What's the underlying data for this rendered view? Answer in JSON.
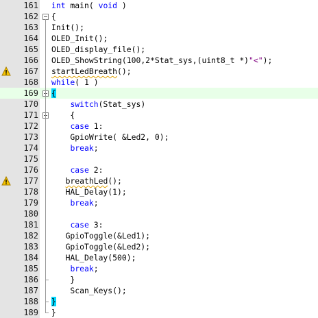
{
  "editor": {
    "lines": [
      {
        "n": "161",
        "segs": [
          {
            "t": "int",
            "c": "kw"
          },
          {
            "t": " main( "
          },
          {
            "t": "void",
            "c": "kw"
          },
          {
            "t": " )"
          }
        ]
      },
      {
        "n": "162",
        "fold": "open",
        "segs": [
          {
            "t": "{"
          }
        ]
      },
      {
        "n": "163",
        "segs": [
          {
            "t": "Init();"
          }
        ]
      },
      {
        "n": "164",
        "segs": [
          {
            "t": "OLED_Init();"
          }
        ]
      },
      {
        "n": "165",
        "segs": [
          {
            "t": "OLED_display_file();"
          }
        ]
      },
      {
        "n": "166",
        "segs": [
          {
            "t": "OLED_ShowString("
          },
          {
            "t": "100",
            "c": "num"
          },
          {
            "t": ","
          },
          {
            "t": "2",
            "c": "num"
          },
          {
            "t": "*Stat_sys,(uint8_t *)"
          },
          {
            "t": "\"<\"",
            "c": "str"
          },
          {
            "t": ");"
          }
        ]
      },
      {
        "n": "167",
        "warn": true,
        "segs": [
          {
            "t": "startLedBreath",
            "c": "warn"
          },
          {
            "t": "();"
          }
        ]
      },
      {
        "n": "168",
        "segs": [
          {
            "t": "while",
            "c": "kw"
          },
          {
            "t": "( "
          },
          {
            "t": "1",
            "c": "num"
          },
          {
            "t": " )"
          }
        ]
      },
      {
        "n": "169",
        "fold": "open",
        "current": true,
        "segs": [
          {
            "t": "{",
            "c": "cursor-brace"
          }
        ]
      },
      {
        "n": "170",
        "segs": [
          {
            "t": "    "
          },
          {
            "t": "switch",
            "c": "kw"
          },
          {
            "t": "(Stat_sys)"
          }
        ]
      },
      {
        "n": "171",
        "fold": "open",
        "segs": [
          {
            "t": "    {"
          }
        ]
      },
      {
        "n": "172",
        "segs": [
          {
            "t": "    "
          },
          {
            "t": "case",
            "c": "kw"
          },
          {
            "t": " "
          },
          {
            "t": "1",
            "c": "num"
          },
          {
            "t": ":"
          }
        ]
      },
      {
        "n": "173",
        "segs": [
          {
            "t": "    GpioWrite( &Led2, "
          },
          {
            "t": "0",
            "c": "num"
          },
          {
            "t": ");"
          }
        ]
      },
      {
        "n": "174",
        "segs": [
          {
            "t": "    "
          },
          {
            "t": "break",
            "c": "kw"
          },
          {
            "t": ";"
          }
        ]
      },
      {
        "n": "175",
        "segs": []
      },
      {
        "n": "176",
        "segs": [
          {
            "t": "    "
          },
          {
            "t": "case",
            "c": "kw"
          },
          {
            "t": " "
          },
          {
            "t": "2",
            "c": "num"
          },
          {
            "t": ":"
          }
        ]
      },
      {
        "n": "177",
        "warn": true,
        "segs": [
          {
            "t": "   "
          },
          {
            "t": "breathLed",
            "c": "warn"
          },
          {
            "t": "();"
          }
        ]
      },
      {
        "n": "178",
        "segs": [
          {
            "t": "   HAL_Delay("
          },
          {
            "t": "1",
            "c": "num"
          },
          {
            "t": ");"
          }
        ]
      },
      {
        "n": "179",
        "segs": [
          {
            "t": "    "
          },
          {
            "t": "break",
            "c": "kw"
          },
          {
            "t": ";"
          }
        ]
      },
      {
        "n": "180",
        "segs": []
      },
      {
        "n": "181",
        "segs": [
          {
            "t": "    "
          },
          {
            "t": "case",
            "c": "kw"
          },
          {
            "t": " "
          },
          {
            "t": "3",
            "c": "num"
          },
          {
            "t": ":"
          }
        ]
      },
      {
        "n": "182",
        "segs": [
          {
            "t": "   GpioToggle(&Led1);"
          }
        ]
      },
      {
        "n": "183",
        "segs": [
          {
            "t": "   GpioToggle(&Led2);"
          }
        ]
      },
      {
        "n": "184",
        "segs": [
          {
            "t": "   HAL_Delay("
          },
          {
            "t": "500",
            "c": "num"
          },
          {
            "t": ");"
          }
        ]
      },
      {
        "n": "185",
        "segs": [
          {
            "t": "    "
          },
          {
            "t": "break",
            "c": "kw"
          },
          {
            "t": ";"
          }
        ]
      },
      {
        "n": "186",
        "segs": [
          {
            "t": "    }"
          }
        ]
      },
      {
        "n": "187",
        "segs": [
          {
            "t": "    Scan_Keys();"
          }
        ]
      },
      {
        "n": "188",
        "segs": [
          {
            "t": "}",
            "c": "cursor-brace"
          }
        ]
      },
      {
        "n": "189",
        "segs": [
          {
            "t": "}"
          }
        ]
      }
    ],
    "icons": {
      "warning": "warning-triangle-icon",
      "fold": "fold-minus-icon"
    },
    "colors": {
      "keyword": "#0000ff",
      "string": "#800080",
      "gutter": "#e4e4e4",
      "current_line": "#e8ffe8",
      "brace_match": "#00d8ff",
      "warning": "#f5c400"
    }
  }
}
